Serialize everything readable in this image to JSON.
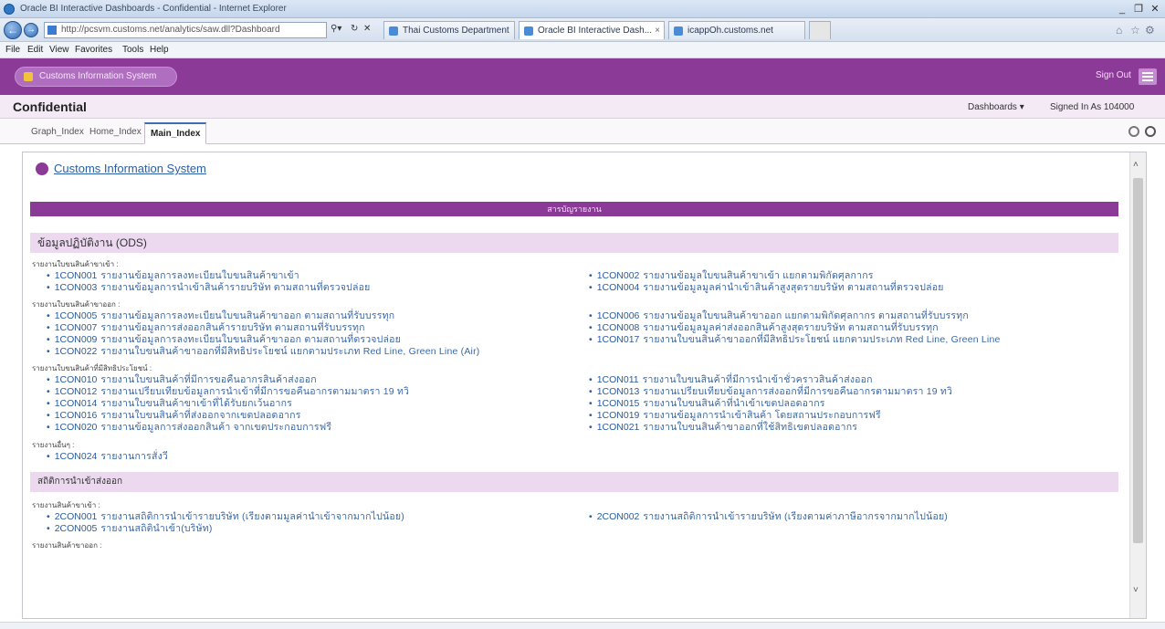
{
  "window": {
    "title": "Oracle BI Interactive Dashboards - Confidential - Internet Explorer",
    "controls": [
      "_",
      "❐",
      "✕"
    ]
  },
  "browser": {
    "address": "http://pcsvm.customs.net/analytics/saw.dll?Dashboard",
    "tabs": [
      {
        "label": "Thai Customs Department",
        "active": false
      },
      {
        "label": "Oracle BI Interactive Dash...",
        "active": true
      },
      {
        "label": "icappOh.customs.net",
        "active": false
      }
    ],
    "menu": [
      "File",
      "Edit",
      "View",
      "Favorites",
      "Tools",
      "Help"
    ]
  },
  "app": {
    "system_button": "Customs Information System",
    "sign_out": "Sign Out"
  },
  "header": {
    "title": "Confidential",
    "dashboards": "Dashboards ▾",
    "signed_in": "Signed In As  104000"
  },
  "page_tabs": [
    {
      "label": "Graph_Index",
      "active": false
    },
    {
      "label": "Home_Index",
      "active": false
    },
    {
      "label": "Main_Index",
      "active": true
    }
  ],
  "content": {
    "cis_title": "Customs Information System",
    "main_bar": "สารบัญรายงาน",
    "section1": "ข้อมูลปฏิบัติงาน (ODS)",
    "section2": "สถิติการนำเข้าส่งออก",
    "groups": {
      "g1": "รายงานใบขนสินค้าขาเข้า :",
      "g2": "รายงานใบขนสินค้าขาออก :",
      "g3": "รายงานใบขนสินค้าที่มีสิทธิประโยชน์ :",
      "g4": "รายงานอื่นๆ :",
      "g5": "รายงานสินค้าขาเข้า :",
      "g6": "รายงานสินค้าขาออก :"
    },
    "items": [
      {
        "code": "1CON001",
        "desc": "รายงานข้อมูลการลงทะเบียนใบขนสินค้าขาเข้า"
      },
      {
        "code": "1CON002",
        "desc": "รายงานข้อมูลใบขนสินค้าขาเข้า แยกตามพิกัดศุลกากร"
      },
      {
        "code": "1CON003",
        "desc": "รายงานข้อมูลการนำเข้าสินค้ารายบริษัท ตามสถานที่ตรวจปล่อย"
      },
      {
        "code": "1CON004",
        "desc": "รายงานข้อมูลมูลค่านำเข้าสินค้าสูงสุดรายบริษัท ตามสถานที่ตรวจปล่อย"
      },
      {
        "code": "1CON005",
        "desc": "รายงานข้อมูลการลงทะเบียนใบขนสินค้าขาออก ตามสถานที่รับบรรทุก"
      },
      {
        "code": "1CON006",
        "desc": "รายงานข้อมูลใบขนสินค้าขาออก แยกตามพิกัดศุลกากร ตามสถานที่รับบรรทุก"
      },
      {
        "code": "1CON007",
        "desc": "รายงานข้อมูลการส่งออกสินค้ารายบริษัท ตามสถานที่รับบรรทุก"
      },
      {
        "code": "1CON008",
        "desc": "รายงานข้อมูลมูลค่าส่งออกสินค้าสูงสุดรายบริษัท ตามสถานที่รับบรรทุก"
      },
      {
        "code": "1CON009",
        "desc": "รายงานข้อมูลการลงทะเบียนใบขนสินค้าขาออก ตามสถานที่ตรวจปล่อย"
      },
      {
        "code": "1CON017",
        "desc": "รายงานใบขนสินค้าขาออกที่มีสิทธิประโยชน์ แยกตามประเภท Red Line, Green Line"
      },
      {
        "code": "1CON022",
        "desc": "รายงานใบขนสินค้าขาออกที่มีสิทธิประโยชน์ แยกตามประเภท Red Line, Green Line (Air)"
      },
      {
        "code": "1CON010",
        "desc": "รายงานใบขนสินค้าที่มีการขอคืนอากรสินค้าส่งออก"
      },
      {
        "code": "1CON011",
        "desc": "รายงานใบขนสินค้าที่มีการนำเข้าชั่วคราวสินค้าส่งออก"
      },
      {
        "code": "1CON012",
        "desc": "รายงานเปรียบเทียบข้อมูลการนำเข้าที่มีการขอคืนอากรตามมาตรา 19 ทวิ"
      },
      {
        "code": "1CON013",
        "desc": "รายงานเปรียบเทียบข้อมูลการส่งออกที่มีการขอคืนอากรตามมาตรา 19 ทวิ"
      },
      {
        "code": "1CON014",
        "desc": "รายงานใบขนสินค้าขาเข้าที่ได้รับยกเว้นอากร"
      },
      {
        "code": "1CON015",
        "desc": "รายงานใบขนสินค้าที่นำเข้าเขตปลอดอากร"
      },
      {
        "code": "1CON016",
        "desc": "รายงานใบขนสินค้าที่ส่งออกจากเขตปลอดอากร"
      },
      {
        "code": "1CON019",
        "desc": "รายงานข้อมูลการนำเข้าสินค้า โดยสถานประกอบการฟรี"
      },
      {
        "code": "1CON020",
        "desc": "รายงานข้อมูลการส่งออกสินค้า จากเขตประกอบการฟรี"
      },
      {
        "code": "1CON021",
        "desc": "รายงานใบขนสินค้าขาออกที่ใช้สิทธิเขตปลอดอากร"
      },
      {
        "code": "1CON024",
        "desc": "รายงานการสั่งวี"
      },
      {
        "code": "2CON001",
        "desc": "รายงานสถิติการนำเข้ารายบริษัท (เรียงตามมูลค่านำเข้าจากมากไปน้อย)"
      },
      {
        "code": "2CON002",
        "desc": "รายงานสถิติการนำเข้ารายบริษัท (เรียงตามค่าภาษีอากรจากมากไปน้อย)"
      },
      {
        "code": "2CON005",
        "desc": "รายงานสถิตินำเข้า(บริษัท)"
      }
    ]
  }
}
